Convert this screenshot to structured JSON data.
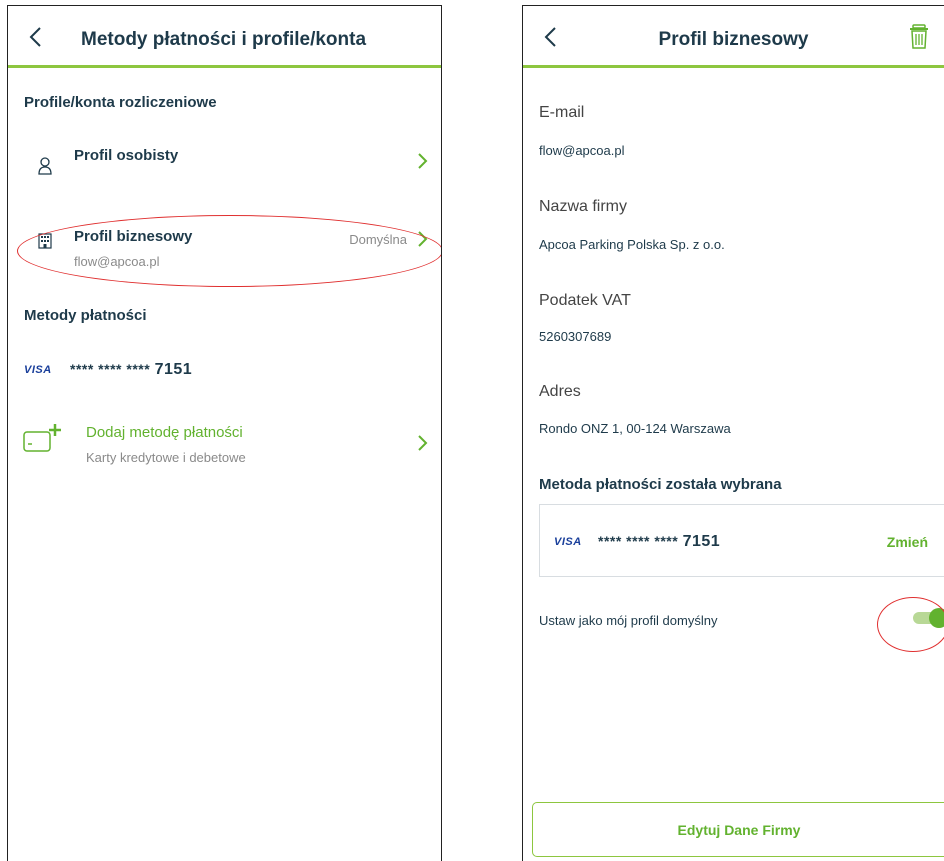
{
  "left_screen": {
    "header": {
      "title": "Metody płatności i profile/konta"
    },
    "profiles_section": {
      "title": "Profile/konta rozliczeniowe"
    },
    "personal_profile": {
      "title": "Profil osobisty"
    },
    "business_profile": {
      "title": "Profil biznesowy",
      "subtitle": "flow@apcoa.pl",
      "badge": "Domyślna"
    },
    "payment_section": {
      "title": "Metody płatności"
    },
    "card": {
      "brand": "VISA",
      "masked": "**** **** ****",
      "last4": "7151"
    },
    "add_payment": {
      "title": "Dodaj metodę płatności",
      "subtitle": "Karty kredytowe i debetowe"
    }
  },
  "right_screen": {
    "header": {
      "title": "Profil biznesowy"
    },
    "fields": [
      {
        "label": "E-mail",
        "value": "flow@apcoa.pl"
      },
      {
        "label": "Nazwa firmy",
        "value": "Apcoa Parking Polska Sp. z o.o."
      },
      {
        "label": "Podatek VAT",
        "value": "5260307689"
      },
      {
        "label": "Adres",
        "value": "Rondo ONZ 1, 00-124 Warszawa"
      }
    ],
    "payment_heading": "Metoda płatności została wybrana",
    "card": {
      "brand": "VISA",
      "masked": "**** **** ****",
      "last4": "7151",
      "change_label": "Zmień"
    },
    "default_toggle": {
      "label": "Ustaw jako mój profil domyślny",
      "on": true
    },
    "edit_button": {
      "label": "Edytuj Dane Firmy"
    }
  },
  "colors": {
    "accent_green": "#62b22f",
    "header_line": "#8dc63f",
    "text_dark": "#1e3a4a",
    "text_muted": "#8a8a8a",
    "annotation_red": "#e03030",
    "visa_blue": "#1a3f9b"
  }
}
